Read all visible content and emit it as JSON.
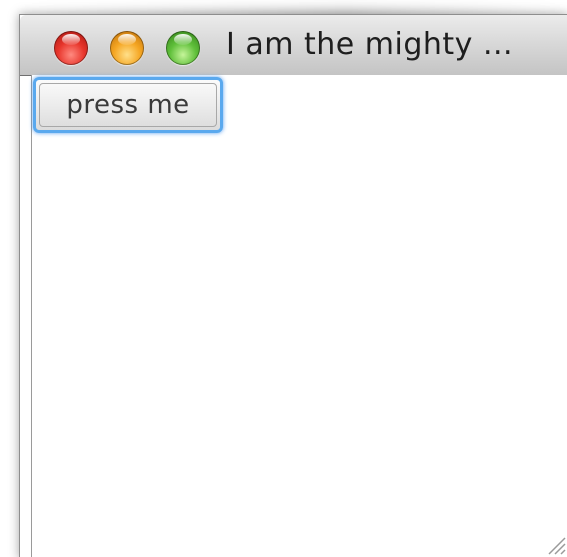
{
  "window": {
    "title": "I am the mighty ..."
  },
  "titlebar": {
    "buttons": [
      {
        "name": "close",
        "color": "#e8362c"
      },
      {
        "name": "minimize",
        "color": "#f5a623"
      },
      {
        "name": "zoom",
        "color": "#5fbf3a"
      }
    ]
  },
  "content": {
    "button_label": "press me",
    "focus_ring_color": "#5aa9ee"
  },
  "icons": {
    "resize": "resize-grip-icon"
  }
}
